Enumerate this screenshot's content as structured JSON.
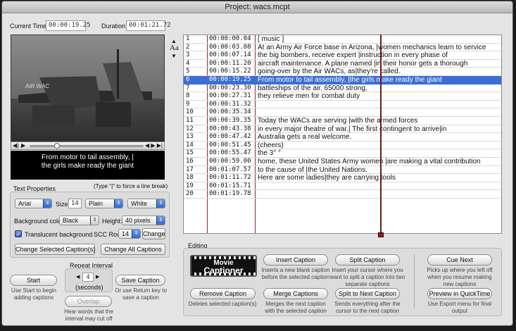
{
  "window": {
    "title": "Project: wacs.mcpt"
  },
  "time": {
    "current_label": "Current Time:",
    "current_value": "00:00:19.25",
    "duration_label": "Duration:",
    "duration_value": "00:01:21.72"
  },
  "video": {
    "subtitle_line1": "From motor to tail assembly, |",
    "subtitle_line2": "the girls make ready the giant",
    "playhead_fraction": 0.24
  },
  "text_properties": {
    "title": "Text Properties",
    "hint": "(Type \"|\" to force a line break)",
    "font": "Arial",
    "size_label": "Size:",
    "size": "14",
    "style": "Plain",
    "color": "White",
    "bg_label": "Background color",
    "bg": "Black",
    "height_label": "Height:",
    "height": "40 pixels",
    "translucent_label": "Translucent background",
    "scc_label": "SCC Row:",
    "scc": "14",
    "change": "Change",
    "change_selected": "Change Selected Caption(s)",
    "change_all": "Change All Captions"
  },
  "repeat": {
    "title": "Repeat Interval",
    "value": "4",
    "unit": "(seconds)",
    "start": "Start",
    "start_hint": "Use Start to begin adding captions",
    "overlap": "Overlap",
    "overlap_hint": "Hear words that the interval may cut off",
    "save": "Save Caption",
    "save_hint": "Or use Return key to save a caption"
  },
  "font_size_toggle": "Aa",
  "captions": [
    {
      "n": "1",
      "t": "00:00:00.04",
      "text": "[ music ]"
    },
    {
      "n": "2",
      "t": "00:00:03.08",
      "text": "At an Army Air Force base in Arizona, |women mechanics learn to service"
    },
    {
      "n": "3",
      "t": "00:00:07.14",
      "text": "the big bombers, receive expert |instruction in every phase of"
    },
    {
      "n": "4",
      "t": "00:00:11.20",
      "text": "aircraft maintenance. A plane named |in their honor gets a thorough"
    },
    {
      "n": "5",
      "t": "00:00:15.22",
      "text": "going-over by the Air WACs, as|they're called."
    },
    {
      "n": "6",
      "t": "00:00:19.25",
      "text": "From motor to tail assembly, |the girls make ready the giant"
    },
    {
      "n": "7",
      "t": "00:00:23.30",
      "text": "battleships of the air. 65000 strong,"
    },
    {
      "n": "8",
      "t": "00:00:27.31",
      "text": "they relieve men for combat duty"
    },
    {
      "n": "9",
      "t": "00:00:31.32",
      "text": ""
    },
    {
      "n": "10",
      "t": "00:00:35.34",
      "text": ""
    },
    {
      "n": "11",
      "t": "00:00:39.35",
      "text": "Today the WACs are serving |with the armed forces"
    },
    {
      "n": "12",
      "t": "00:00:43.38",
      "text": "in every major theatre of war.| The first contingent to arrive|in"
    },
    {
      "n": "13",
      "t": "00:00:47.42",
      "text": "Australia gets a real welcome."
    },
    {
      "n": "14",
      "t": "00:00:51.45",
      "text": "(cheers)"
    },
    {
      "n": "15",
      "t": "00:00:55.47",
      "text": "the 3° °"
    },
    {
      "n": "16",
      "t": "00:00:59.00",
      "text": "home, these United States Army women |are making a vital contribution"
    },
    {
      "n": "17",
      "t": "00:01:07.57",
      "text": "to the cause of |the United Nations."
    },
    {
      "n": "18",
      "t": "00:01:11.72",
      "text": "Here are some ladies|they are carrying tools"
    },
    {
      "n": "19",
      "t": "00:01:15.71",
      "text": ""
    },
    {
      "n": "20",
      "t": "00:01:19.78",
      "text": ""
    }
  ],
  "selected_row": 6,
  "editing": {
    "title": "Editing",
    "logo_line1": "Movie",
    "logo_line2": "Captioner",
    "insert": "Insert Caption",
    "insert_hint": "Inserts a new blank caption before the selected caption",
    "split": "Split Caption",
    "split_hint": "Insert your cursor where you want to split a caption into two separate captions",
    "remove": "Remove Caption",
    "remove_hint": "Deletes selected caption(s)",
    "merge": "Merge Captions",
    "merge_hint": "Merges the next caption with the selected caption",
    "split_next": "Split to Next Caption",
    "split_next_hint": "Sends everything after the cursor to the next caption",
    "cue": "Cue Next",
    "cue_hint": "Picks up where you left off when you resume making new captions",
    "preview": "Preview in QuickTime",
    "preview_hint": "Use Export menu for final output"
  }
}
